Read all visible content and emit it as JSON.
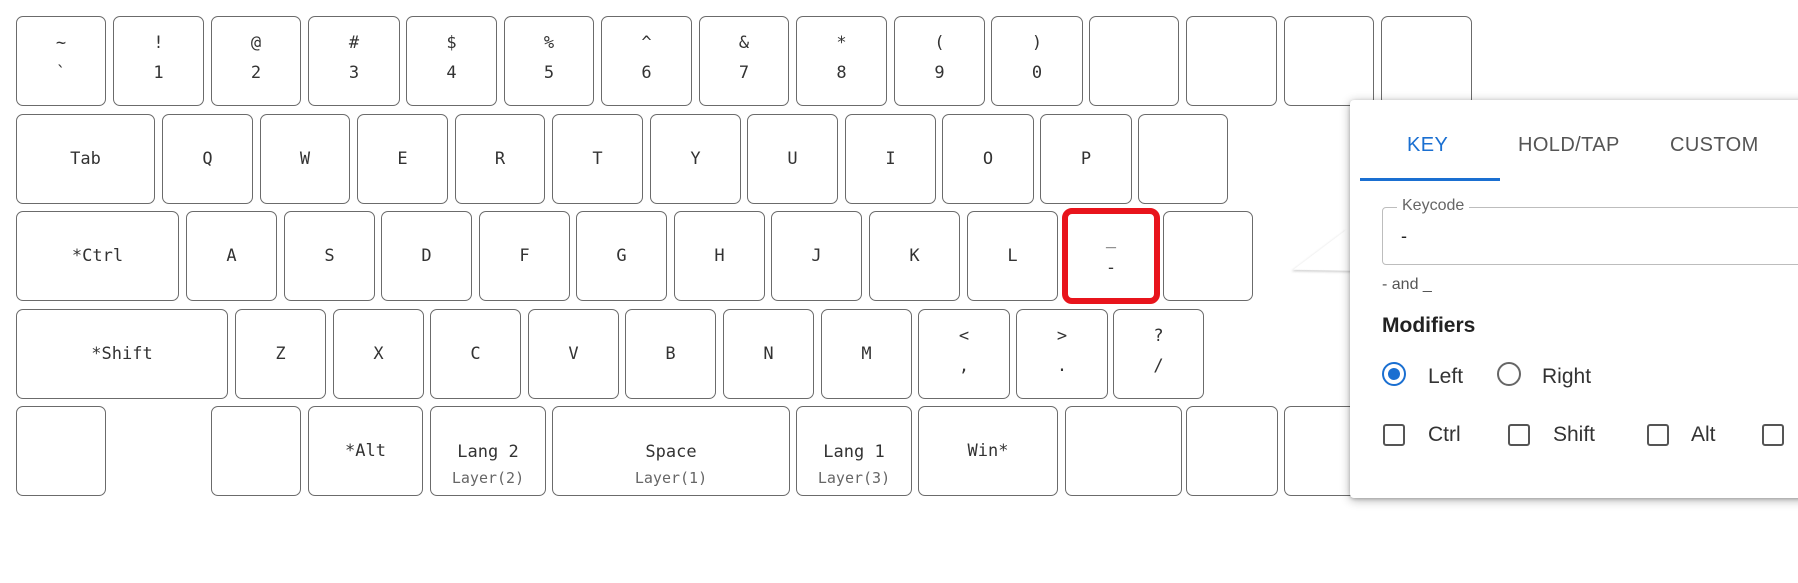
{
  "keyboard": {
    "rows": [
      [
        {
          "top": "~",
          "bottom": "`"
        },
        {
          "top": "!",
          "bottom": "1"
        },
        {
          "top": "@",
          "bottom": "2"
        },
        {
          "top": "#",
          "bottom": "3"
        },
        {
          "top": "$",
          "bottom": "4"
        },
        {
          "top": "%",
          "bottom": "5"
        },
        {
          "top": "^",
          "bottom": "6"
        },
        {
          "top": "&",
          "bottom": "7"
        },
        {
          "top": "*",
          "bottom": "8"
        },
        {
          "top": "(",
          "bottom": "9"
        },
        {
          "top": ")",
          "bottom": "0"
        },
        {},
        {},
        {},
        {}
      ],
      [
        {
          "label": "Tab"
        },
        {
          "label": "Q"
        },
        {
          "label": "W"
        },
        {
          "label": "E"
        },
        {
          "label": "R"
        },
        {
          "label": "T"
        },
        {
          "label": "Y"
        },
        {
          "label": "U"
        },
        {
          "label": "I"
        },
        {
          "label": "O"
        },
        {
          "label": "P"
        },
        {}
      ],
      [
        {
          "label": "*Ctrl"
        },
        {
          "label": "A"
        },
        {
          "label": "S"
        },
        {
          "label": "D"
        },
        {
          "label": "F"
        },
        {
          "label": "G"
        },
        {
          "label": "H"
        },
        {
          "label": "J"
        },
        {
          "label": "K"
        },
        {
          "label": "L"
        },
        {
          "top": "_",
          "bottom": "-",
          "selected": true
        },
        {}
      ],
      [
        {
          "label": "*Shift"
        },
        {
          "label": "Z"
        },
        {
          "label": "X"
        },
        {
          "label": "C"
        },
        {
          "label": "V"
        },
        {
          "label": "B"
        },
        {
          "label": "N"
        },
        {
          "label": "M"
        },
        {
          "top": "<",
          "bottom": ","
        },
        {
          "top": ">",
          "bottom": "."
        },
        {
          "top": "?",
          "bottom": "/"
        }
      ],
      [
        {},
        {},
        {
          "label": "*Alt"
        },
        {
          "main": "Lang 2",
          "sub": "Layer(2)"
        },
        {
          "main": "Space",
          "sub": "Layer(1)"
        },
        {
          "main": "Lang 1",
          "sub": "Layer(3)"
        },
        {
          "label": "Win*"
        },
        {},
        {},
        {},
        {}
      ]
    ]
  },
  "popup": {
    "tabs": [
      "KEY",
      "HOLD/TAP",
      "CUSTOM"
    ],
    "active_tab": "KEY",
    "keycode_label": "Keycode",
    "keycode_value": "-",
    "keycode_helper": "- and _",
    "modifiers_heading": "Modifiers",
    "side_left": "Left",
    "side_right": "Right",
    "selected_side": "Left",
    "mods": [
      "Ctrl",
      "Shift",
      "Alt"
    ],
    "accent_color": "#1a6fd1",
    "highlight_color": "#e8141c"
  }
}
